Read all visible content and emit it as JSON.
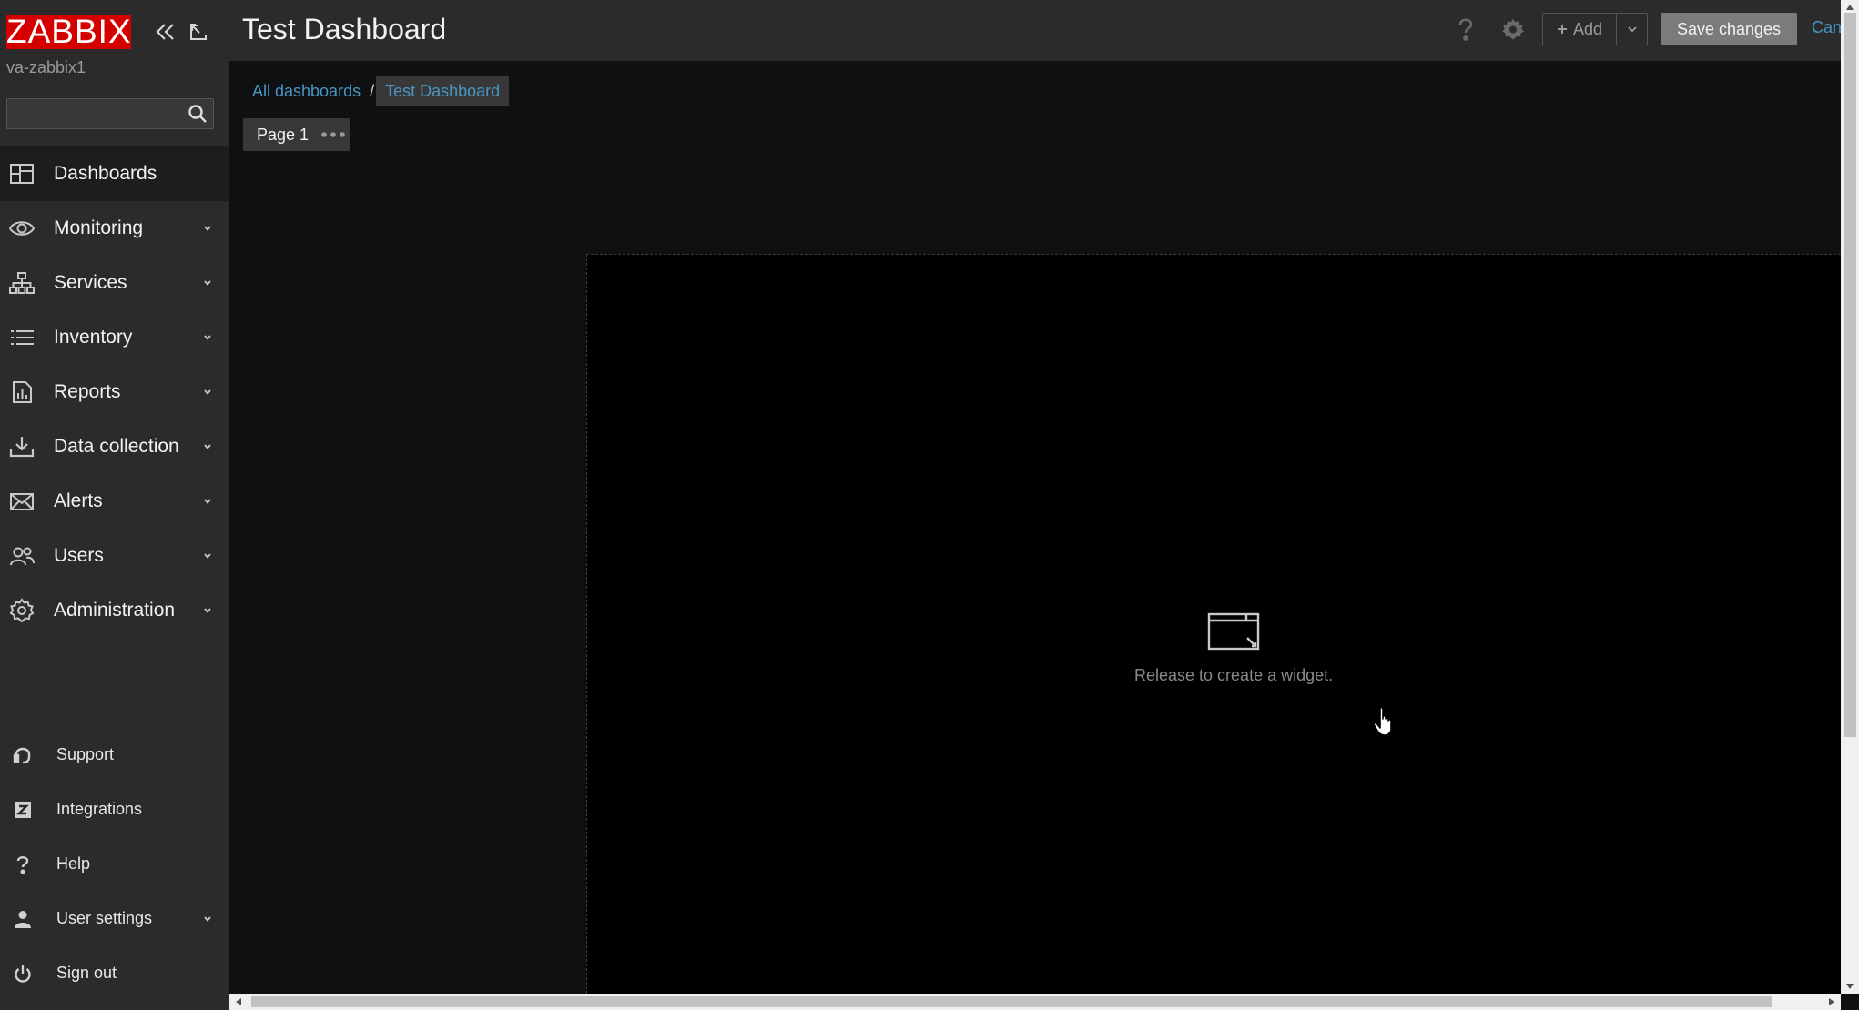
{
  "app": {
    "logo_text": "ZABBIX",
    "server_name": "va-zabbix1",
    "brand_color": "#d40000"
  },
  "sidebar": {
    "search_placeholder": "",
    "menu": [
      {
        "label": "Dashboards",
        "icon": "dashboards-icon",
        "active": true,
        "expandable": false
      },
      {
        "label": "Monitoring",
        "icon": "eye-icon",
        "expandable": true
      },
      {
        "label": "Services",
        "icon": "services-icon",
        "expandable": true
      },
      {
        "label": "Inventory",
        "icon": "list-icon",
        "expandable": true
      },
      {
        "label": "Reports",
        "icon": "reports-icon",
        "expandable": true
      },
      {
        "label": "Data collection",
        "icon": "download-icon",
        "expandable": true
      },
      {
        "label": "Alerts",
        "icon": "envelope-icon",
        "expandable": true
      },
      {
        "label": "Users",
        "icon": "users-icon",
        "expandable": true
      },
      {
        "label": "Administration",
        "icon": "gear-icon",
        "expandable": true
      }
    ],
    "bottom_menu": [
      {
        "label": "Support",
        "icon": "headset-icon",
        "expandable": false
      },
      {
        "label": "Integrations",
        "icon": "z-icon",
        "expandable": false
      },
      {
        "label": "Help",
        "icon": "question-icon",
        "expandable": false
      },
      {
        "label": "User settings",
        "icon": "user-icon",
        "expandable": true
      },
      {
        "label": "Sign out",
        "icon": "power-icon",
        "expandable": false
      }
    ]
  },
  "header": {
    "title": "Test Dashboard",
    "add_label": "Add",
    "save_label": "Save changes",
    "cancel_label": "Can",
    "link_color": "#4796c4"
  },
  "breadcrumb": {
    "all": "All dashboards",
    "separator": "/",
    "current": "Test Dashboard"
  },
  "pages": {
    "tabs": [
      {
        "label": "Page 1"
      }
    ]
  },
  "dashboard": {
    "placeholder_text": "Release to create a widget."
  }
}
